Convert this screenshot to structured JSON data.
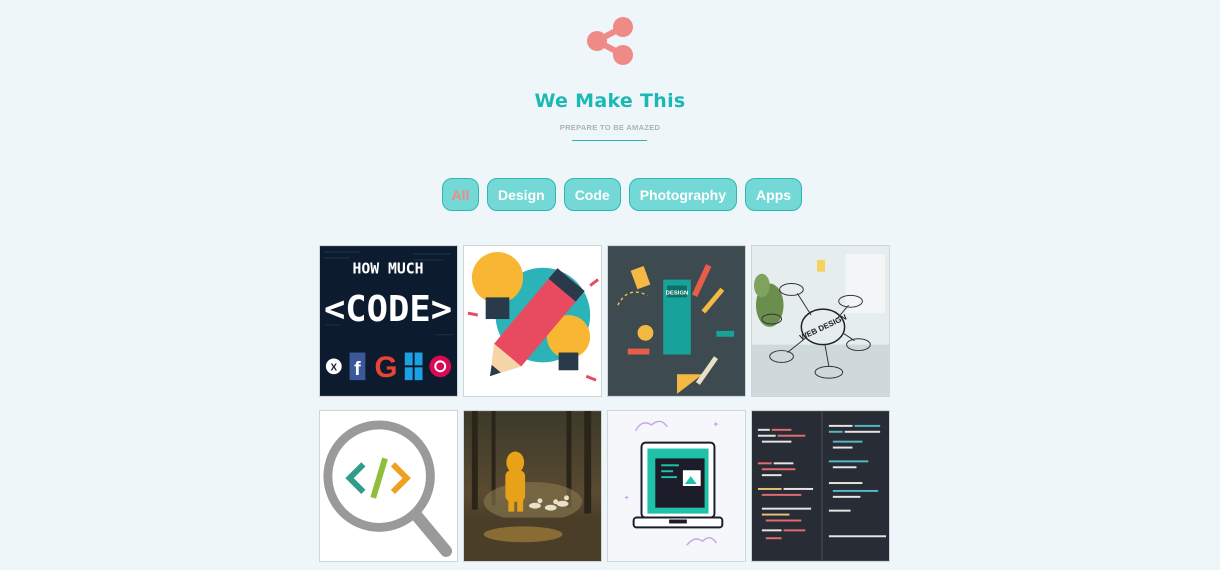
{
  "header": {
    "icon": "share-icon",
    "title": "We Make This",
    "subtitle": "PREPARE TO BE AMAZED",
    "accent_color": "#1cb9b4",
    "icon_color": "#ef8b87"
  },
  "filters": [
    {
      "label": "All",
      "active": true
    },
    {
      "label": "Design",
      "active": false
    },
    {
      "label": "Code",
      "active": false
    },
    {
      "label": "Photography",
      "active": false
    },
    {
      "label": "Apps",
      "active": false
    }
  ],
  "portfolio": {
    "items": [
      {
        "name": "how-much-code-thumbnail",
        "text_lines": [
          "HOW MUCH",
          "<CODE>"
        ]
      },
      {
        "name": "pencil-lightbulb-thumbnail"
      },
      {
        "name": "design-tools-thumbnail",
        "text": "DESIGN"
      },
      {
        "name": "web-design-sketch-thumbnail",
        "text": "WEB DESIGN"
      },
      {
        "name": "code-magnifier-thumbnail",
        "text": "</>"
      },
      {
        "name": "child-ducks-photo-thumbnail"
      },
      {
        "name": "laptop-illustration-thumbnail"
      },
      {
        "name": "code-editor-thumbnail"
      }
    ]
  }
}
